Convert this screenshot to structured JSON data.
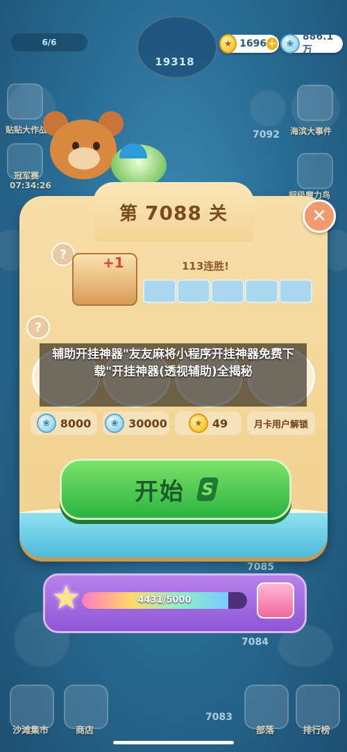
{
  "hud": {
    "progress": "6/6",
    "current_level": "19318",
    "gold": "1696",
    "diamonds": "886.1万"
  },
  "map": {
    "left_labels": [
      "贴贴大作战",
      "冠军赛",
      "07:34:26"
    ],
    "right_labels": [
      "海滨大事件",
      "超级魔力鸟"
    ],
    "level_chips": [
      "7092",
      "7085",
      "7084",
      "7083"
    ]
  },
  "dialog": {
    "level_prefix": "第",
    "level_number": "7088",
    "level_suffix": "关",
    "close_symbol": "✕",
    "help_symbol": "?",
    "streak_plus": "+1",
    "streak_label": "113连胜!",
    "streak_filled": 0,
    "streak_total": 5,
    "overlay_title": "辅助开挂神器\"友友麻将小程序开挂神器免费下载\"开挂神器(透视辅助)全揭秘",
    "prices": [
      {
        "icon": "diamond-coin",
        "value": "8000"
      },
      {
        "icon": "diamond-coin",
        "value": "30000"
      },
      {
        "icon": "gold-coin",
        "value": "49"
      }
    ],
    "month_card": "月卡用户解锁",
    "start_label": "开始",
    "start_icon_glyph": "S"
  },
  "reward_bar": {
    "current": 4431,
    "total": 5000,
    "text": "4431/5000"
  },
  "nav": {
    "items": [
      "沙滩集市",
      "商店",
      "部落",
      "排行榜"
    ]
  },
  "colors": {
    "panel": "#f4d79c",
    "start_green": "#2bb33f",
    "bar_purple": "#8e55d6",
    "close_orange": "#f29a6f"
  }
}
